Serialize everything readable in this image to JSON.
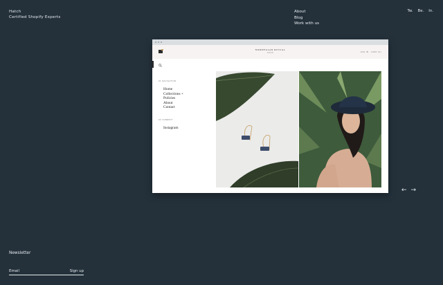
{
  "brand": {
    "name": "Hatch",
    "tagline": "Certified Shopify Experts"
  },
  "nav": {
    "items": [
      "About",
      "Blog",
      "Work with us"
    ]
  },
  "social": [
    "Tw.",
    "Be.",
    "In."
  ],
  "preview": {
    "site_title": "NORWEGIAN RITUAL",
    "site_subtitle": "SHOP",
    "cart": "LOG IN · CART (0)",
    "sections": [
      {
        "label": "01  NAVIGATION",
        "items": [
          "Home",
          "Collections +",
          "Policies",
          "About",
          "Contact"
        ]
      },
      {
        "label": "02  CONNECT",
        "items": [
          "Instagram"
        ]
      }
    ]
  },
  "carousel": {
    "prev_icon": "←",
    "next_icon": "→"
  },
  "newsletter": {
    "title": "Newsletter",
    "placeholder": "Email",
    "submit": "Sign up"
  },
  "colors": {
    "background": "#24313b",
    "text": "#e6ebee",
    "preview_header": "#f7f3f2"
  }
}
